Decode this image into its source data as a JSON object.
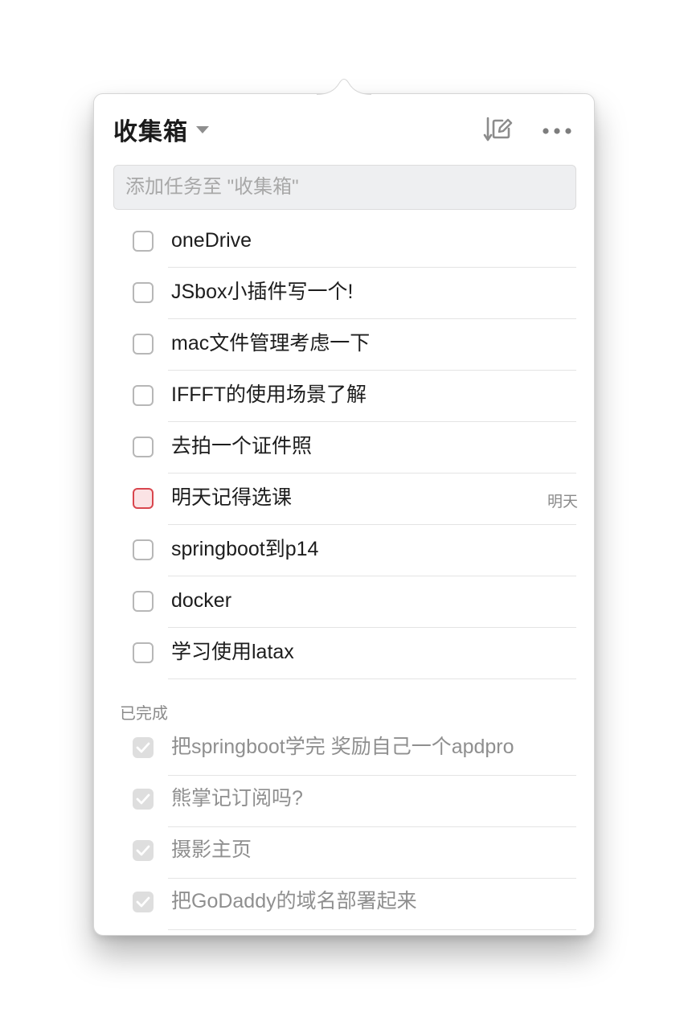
{
  "header": {
    "title": "收集箱"
  },
  "add_task": {
    "placeholder": "添加任务至 \"收集箱\""
  },
  "tasks": [
    {
      "label": "oneDrive"
    },
    {
      "label": "JSbox小插件写一个!"
    },
    {
      "label": "mac文件管理考虑一下"
    },
    {
      "label": "IFFFT的使用场景了解"
    },
    {
      "label": "去拍一个证件照"
    },
    {
      "label": "明天记得选课",
      "due": "明天",
      "priority": "high",
      "priority_color": "#d9464e"
    },
    {
      "label": "springboot到p14"
    },
    {
      "label": "docker"
    },
    {
      "label": "学习使用latax"
    }
  ],
  "completed": {
    "header": "已完成",
    "items": [
      {
        "label": "把springboot学完 奖励自己一个apdpro"
      },
      {
        "label": "熊掌记订阅吗?"
      },
      {
        "label": "摄影主页"
      },
      {
        "label": "把GoDaddy的域名部署起来"
      }
    ]
  },
  "icons": {
    "sort": "sort-edit-icon",
    "more": "more-icon",
    "dropdown": "chevron-down-icon",
    "check": "checkmark-icon"
  }
}
